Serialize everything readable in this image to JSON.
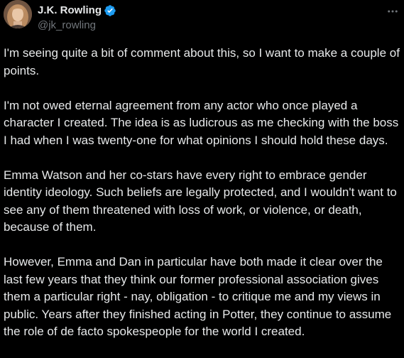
{
  "author": {
    "display_name": "J.K. Rowling",
    "handle": "@jk_rowling",
    "verified": true,
    "verified_color": "#1d9bf0"
  },
  "icons": {
    "avatar": "avatar-photo",
    "verified": "verified-badge-icon",
    "more": "more-options-icon"
  },
  "tweet": {
    "paragraphs": [
      "I'm seeing quite a bit of comment about this, so I want to make a couple of points.",
      "I'm not owed eternal agreement from any actor who once played a character I created. The idea is as ludicrous as me checking with the boss I had when I was twenty-one for what opinions I should hold these days.",
      "Emma Watson and her co-stars have every right to embrace gender identity ideology. Such beliefs are legally protected, and I wouldn't want to see any of them threatened with loss of work, or violence, or death, because of them.",
      "However, Emma and Dan in particular have both made it clear over the last few years that they think our former professional association gives them a particular right - nay, obligation - to critique me and my views in public. Years after they finished acting in Potter, they continue to assume the role of de facto spokespeople for the world I created."
    ]
  },
  "colors": {
    "background": "#000000",
    "text": "#e7e9ea",
    "secondary_text": "#71767b"
  }
}
